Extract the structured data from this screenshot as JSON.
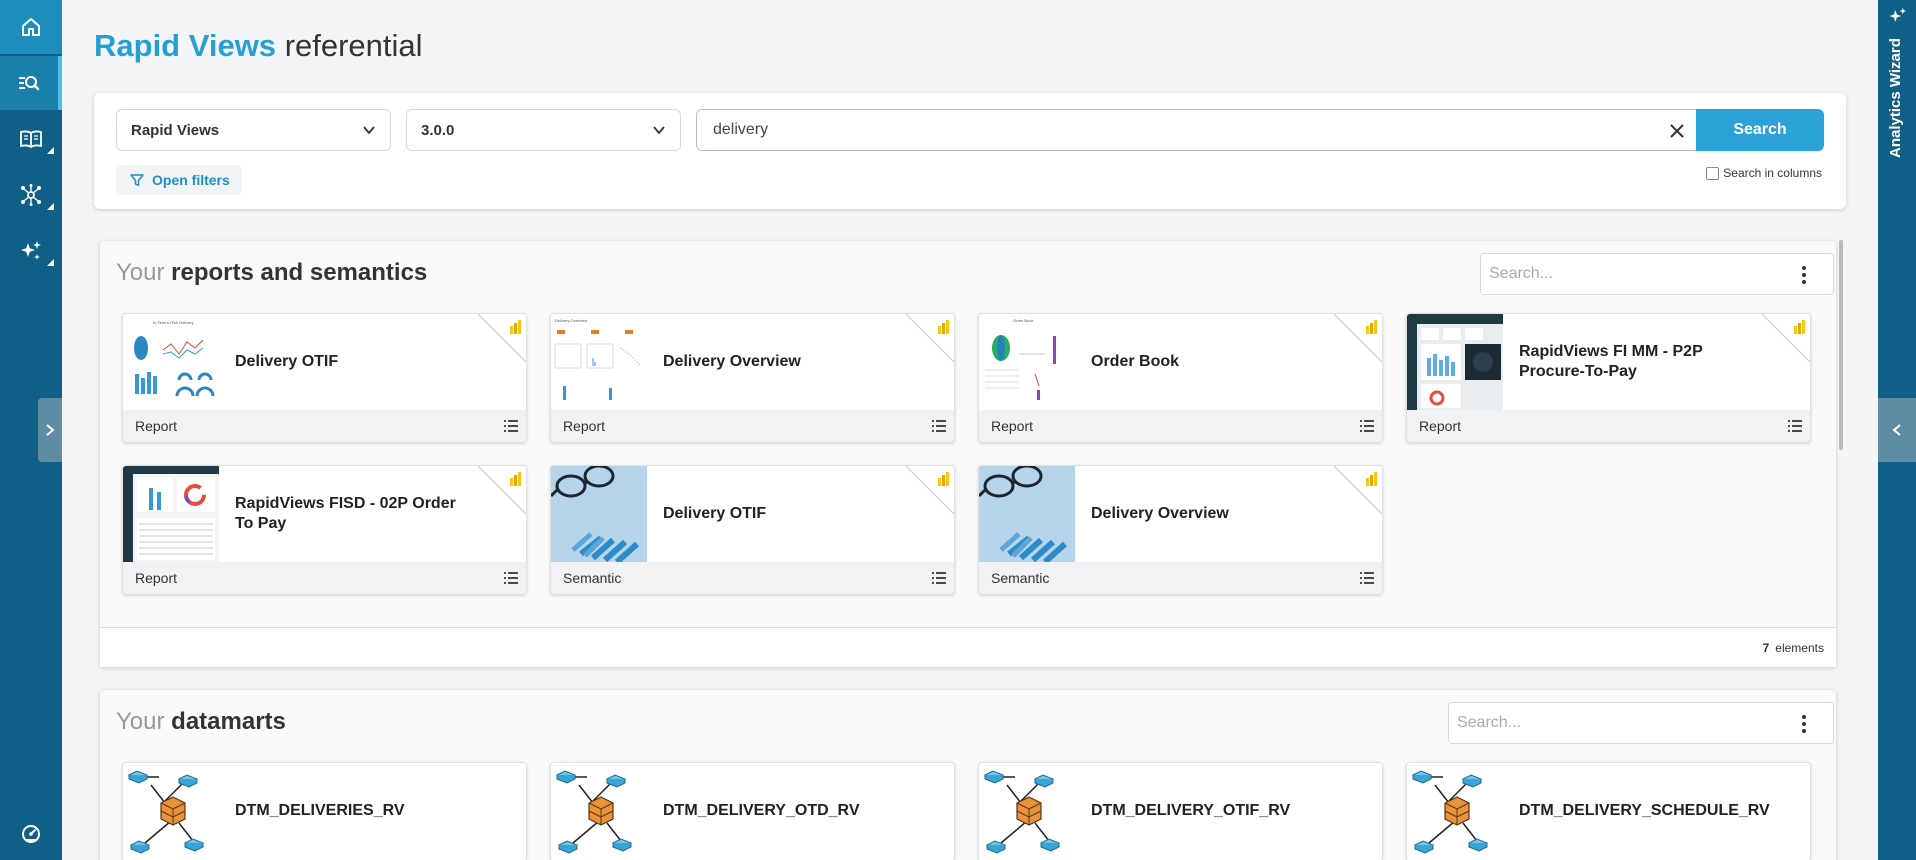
{
  "page": {
    "title_brand": "Rapid Views",
    "title_rest": "referential"
  },
  "sidebar": {
    "items": [
      {
        "name": "home"
      },
      {
        "name": "search"
      },
      {
        "name": "book"
      },
      {
        "name": "network"
      },
      {
        "name": "sparkles"
      }
    ]
  },
  "right_panel": {
    "title": "Analytics Wizard"
  },
  "search_panel": {
    "product": "Rapid Views",
    "version": "3.0.0",
    "query": "delivery",
    "search_label": "Search",
    "open_filters": "Open filters",
    "search_in_columns": "Search in columns"
  },
  "reports_section": {
    "title_light": "Your",
    "title_strong": "reports and semantics",
    "search_placeholder": "Search...",
    "count": "7",
    "count_label": "elements",
    "cards": [
      {
        "name": "Delivery OTIF",
        "type": "Report",
        "thumb": "chart"
      },
      {
        "name": "Delivery Overview",
        "type": "Report",
        "thumb": "chart"
      },
      {
        "name": "Order Book",
        "type": "Report",
        "thumb": "chart"
      },
      {
        "name": "RapidViews FI MM - P2P Procure-To-Pay",
        "type": "Report",
        "thumb": "dashboard"
      },
      {
        "name": "RapidViews FISD - 02P Order To Pay",
        "type": "Report",
        "thumb": "dashboard"
      },
      {
        "name": "Delivery OTIF",
        "type": "Semantic",
        "thumb": "photo"
      },
      {
        "name": "Delivery Overview",
        "type": "Semantic",
        "thumb": "photo"
      }
    ]
  },
  "datamarts_section": {
    "title_light": "Your",
    "title_strong": "datamarts",
    "search_placeholder": "Search...",
    "cards": [
      {
        "name": "DTM_DELIVERIES_RV"
      },
      {
        "name": "DTM_DELIVERY_OTD_RV"
      },
      {
        "name": "DTM_DELIVERY_OTIF_RV"
      },
      {
        "name": "DTM_DELIVERY_SCHEDULE_RV"
      }
    ]
  },
  "colors": {
    "sidebar": "#0f5f86",
    "accent": "#2ba2d6",
    "powerbi": "#f2c811"
  }
}
